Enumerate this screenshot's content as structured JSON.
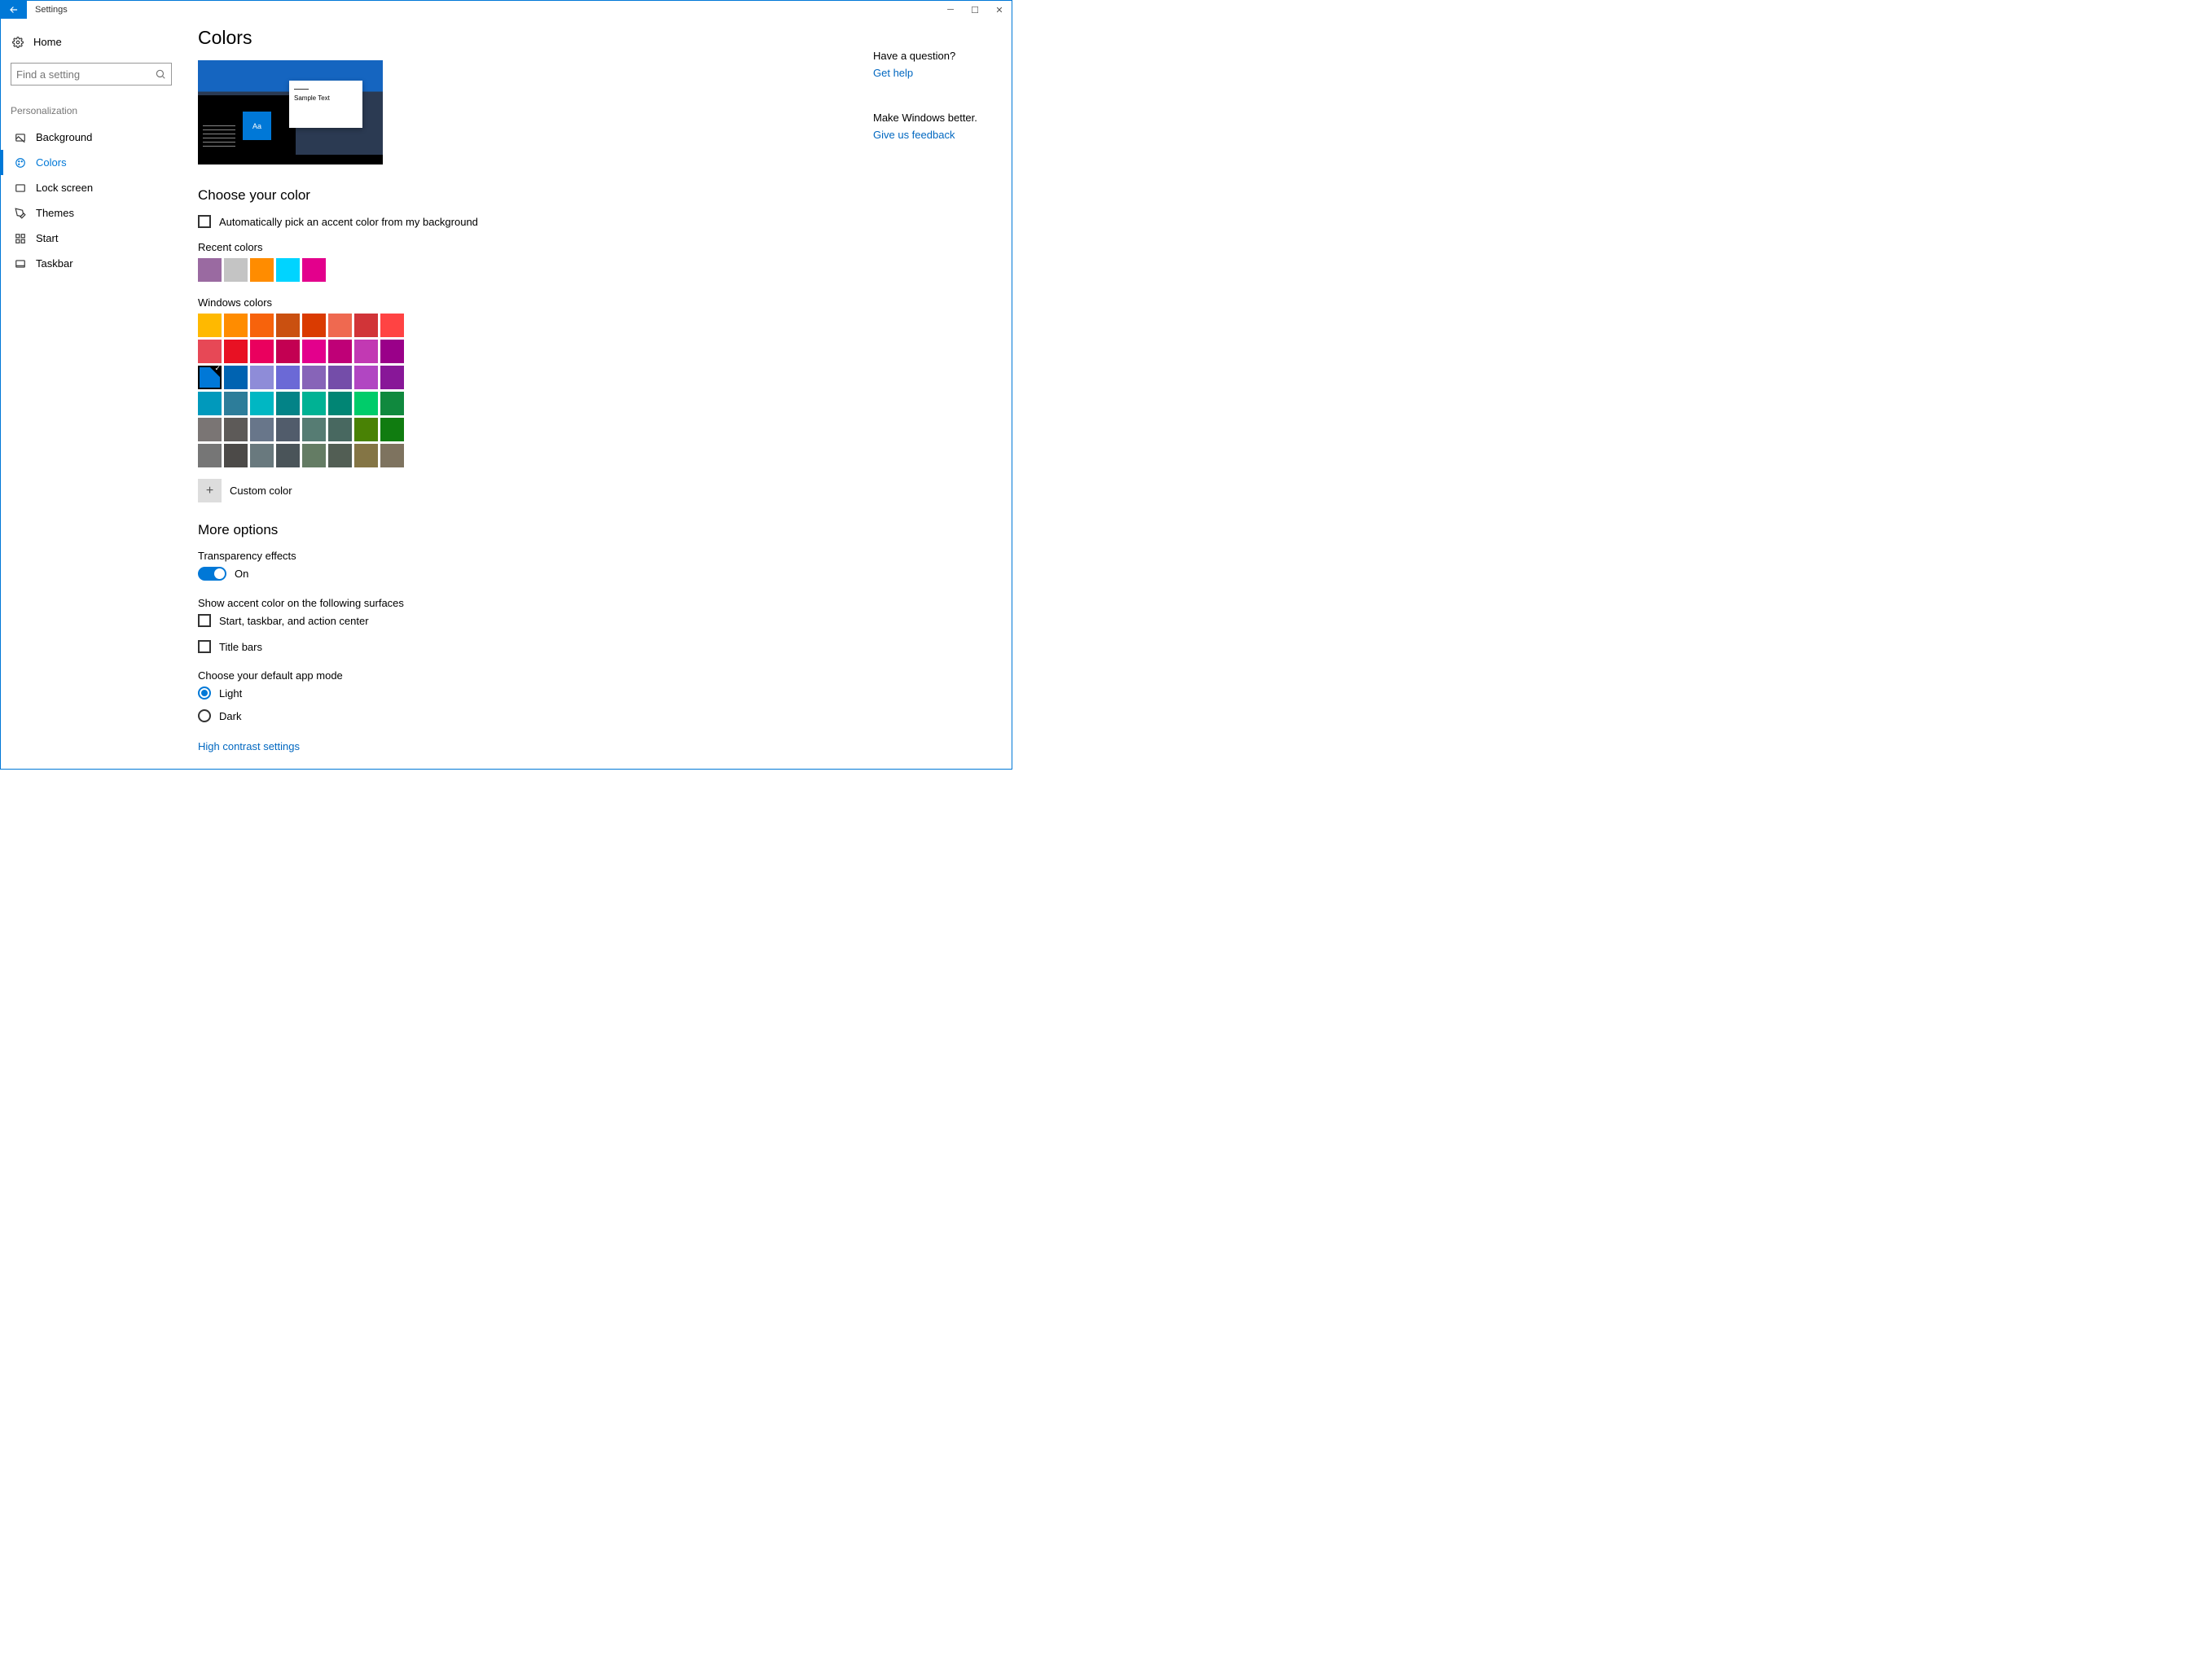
{
  "titlebar": {
    "title": "Settings"
  },
  "sidebar": {
    "home": "Home",
    "search_placeholder": "Find a setting",
    "category": "Personalization",
    "items": [
      {
        "label": "Background"
      },
      {
        "label": "Colors"
      },
      {
        "label": "Lock screen"
      },
      {
        "label": "Themes"
      },
      {
        "label": "Start"
      },
      {
        "label": "Taskbar"
      }
    ]
  },
  "main": {
    "title": "Colors",
    "preview": {
      "sample_text": "Sample Text",
      "tile_text": "Aa"
    },
    "choose_color_heading": "Choose your color",
    "auto_pick_label": "Automatically pick an accent color from my background",
    "recent_heading": "Recent colors",
    "recent_colors": [
      "#9a6aa1",
      "#c4c4c4",
      "#ff8c00",
      "#00d4ff",
      "#e3008c"
    ],
    "windows_colors_heading": "Windows colors",
    "windows_colors": [
      "#ffb900",
      "#ff8c00",
      "#f7630c",
      "#ca5010",
      "#da3b01",
      "#ef6950",
      "#d13438",
      "#ff4343",
      "#e74856",
      "#e81123",
      "#ea005e",
      "#c30052",
      "#e3008c",
      "#bf0077",
      "#c239b3",
      "#9a0089",
      "#0078d7",
      "#0063b1",
      "#8e8cd8",
      "#6b69d6",
      "#8764b8",
      "#744da9",
      "#b146c2",
      "#881798",
      "#0099bc",
      "#2d7d9a",
      "#00b7c3",
      "#038387",
      "#00b294",
      "#018574",
      "#00cc6a",
      "#10893e",
      "#7a7574",
      "#5d5a58",
      "#68768a",
      "#515c6b",
      "#567c73",
      "#486860",
      "#498205",
      "#107c10",
      "#767676",
      "#4c4a48",
      "#69797e",
      "#4a5459",
      "#647c64",
      "#525e54",
      "#847545",
      "#7e735f"
    ],
    "selected_color_index": 16,
    "custom_color_label": "Custom color",
    "more_options_heading": "More options",
    "transparency_label": "Transparency effects",
    "transparency_state": "On",
    "surfaces_heading": "Show accent color on the following surfaces",
    "surface_start": "Start, taskbar, and action center",
    "surface_titlebars": "Title bars",
    "app_mode_heading": "Choose your default app mode",
    "mode_light": "Light",
    "mode_dark": "Dark",
    "high_contrast_link": "High contrast settings"
  },
  "aside": {
    "question": "Have a question?",
    "get_help": "Get help",
    "better": "Make Windows better.",
    "feedback": "Give us feedback"
  }
}
